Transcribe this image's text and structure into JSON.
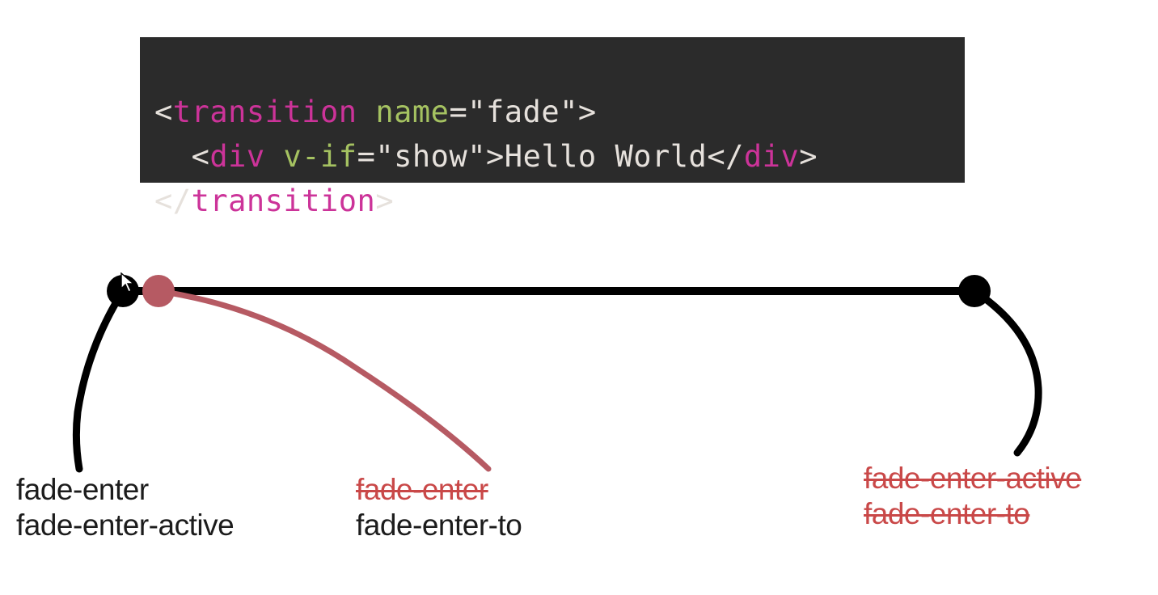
{
  "code": {
    "line1": {
      "open_bracket": "<",
      "tag": "transition",
      "attr": "name",
      "eq": "=",
      "q1": "\"",
      "val": "fade",
      "q2": "\"",
      "close_bracket": ">"
    },
    "line2": {
      "indent": "  ",
      "open_bracket": "<",
      "tag": "div",
      "attr": "v-if",
      "eq": "=",
      "q1": "\"",
      "val": "show",
      "q2": "\"",
      "close_bracket": ">",
      "text": "Hello World",
      "end_open": "</",
      "end_tag": "div",
      "end_close": ">"
    },
    "line3": {
      "end_open": "</",
      "tag": "transition",
      "end_close": ">"
    }
  },
  "labels": {
    "left_line1": "fade-enter",
    "left_line2": "fade-enter-active",
    "mid_strike": "fade-enter",
    "mid_line2": "fade-enter-to",
    "right_strike1": "fade-enter-active",
    "right_strike2": "fade-enter-to"
  },
  "colors": {
    "code_bg": "#2b2b2b",
    "tag": "#cc3399",
    "attr": "#a5c261",
    "plain": "#e6e1dc",
    "line_red": "#b65a63",
    "strike_red": "#c94848",
    "black": "#000000"
  }
}
